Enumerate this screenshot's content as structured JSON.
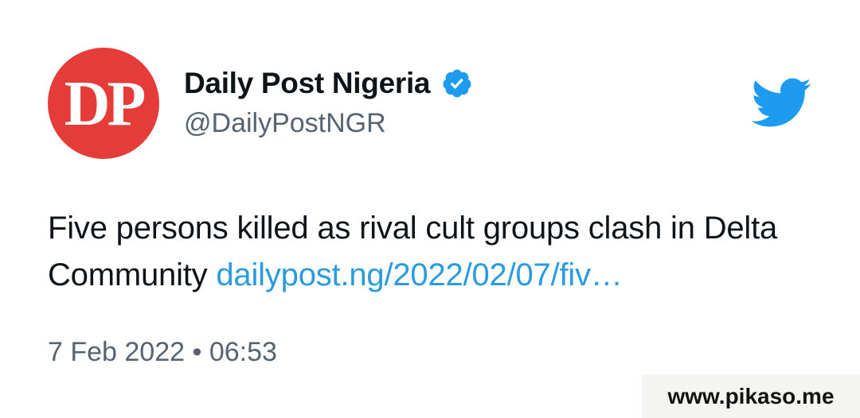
{
  "account": {
    "avatar_text": "DP",
    "display_name": "Daily Post Nigeria",
    "handle": "@DailyPostNGR",
    "verified": true
  },
  "tweet": {
    "text": "Five persons killed as rival cult groups clash in Delta Community ",
    "link_text": "dailypost.ng/2022/02/07/fiv…",
    "date": "7 Feb 2022",
    "separator": "•",
    "time": "06:53"
  },
  "watermark": {
    "text": "www.pikaso.me"
  },
  "icons": {
    "verified": "verified-badge-icon",
    "brand": "twitter-bird-icon"
  },
  "colors": {
    "avatar_bg": "#e53c3a",
    "verified": "#1d9bf0",
    "twitter_blue": "#1d9bf0",
    "link": "#2b9be0",
    "secondary_text": "#566370",
    "primary_text": "#0f1419"
  }
}
